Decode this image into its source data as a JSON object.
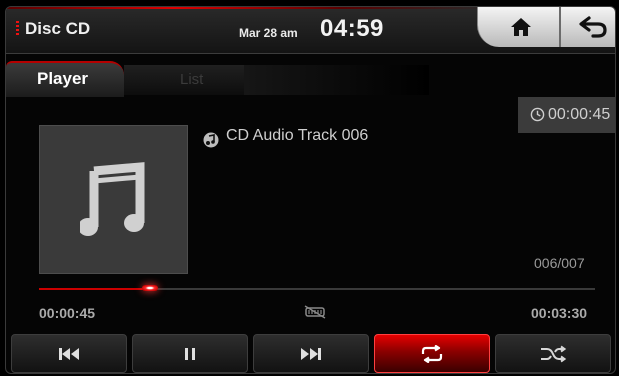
{
  "header": {
    "source_title": "Disc CD",
    "date": "Mar 28 am",
    "clock": "04:59",
    "home_icon": "home-icon",
    "back_icon": "back-arrow-icon"
  },
  "tabs": [
    {
      "label": "Player",
      "active": true
    },
    {
      "label": "List",
      "active": false
    }
  ],
  "player": {
    "elapsed_badge": "00:00:45",
    "track_title": "CD Audio Track 006",
    "track_index": "006/007",
    "time_elapsed": "00:00:45",
    "time_total": "00:03:30",
    "progress_fraction": 0.21
  },
  "controls": [
    {
      "name": "previous",
      "icon": "skip-previous-icon",
      "active": false
    },
    {
      "name": "pause",
      "icon": "pause-icon",
      "active": false
    },
    {
      "name": "next",
      "icon": "skip-next-icon",
      "active": false
    },
    {
      "name": "repeat",
      "icon": "repeat-icon",
      "active": true
    },
    {
      "name": "shuffle",
      "icon": "shuffle-icon",
      "active": false
    }
  ],
  "colors": {
    "accent": "#cc0000",
    "background": "#000000"
  }
}
